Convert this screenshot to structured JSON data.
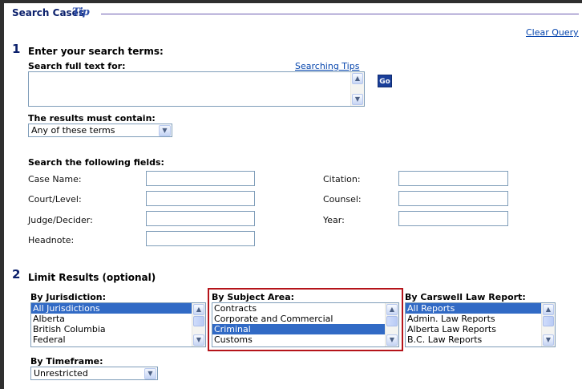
{
  "header": {
    "title": "Search Cases",
    "tip_logo": "Tip"
  },
  "clear_query": "Clear Query",
  "step1": {
    "number": "1",
    "heading": "Enter your search terms:",
    "full_text_label": "Search full text for:",
    "searching_tips": "Searching Tips",
    "full_text_value": "",
    "go_label": "Go",
    "must_contain_label": "The results must contain:",
    "must_contain_value": "Any of these terms"
  },
  "fields": {
    "heading": "Search the following fields:",
    "case_name": "Case Name:",
    "court_level": "Court/Level:",
    "judge_decider": "Judge/Decider:",
    "headnote": "Headnote:",
    "citation": "Citation:",
    "counsel": "Counsel:",
    "year": "Year:"
  },
  "step2": {
    "number": "2",
    "heading": "Limit Results (optional)",
    "jurisdiction": {
      "label": "By Jurisdiction:",
      "options": [
        "All Jurisdictions",
        "Alberta",
        "British Columbia",
        "Federal"
      ],
      "selected_index": 0
    },
    "subject": {
      "label": "By Subject Area:",
      "options": [
        "Contracts",
        "Corporate and Commercial",
        "Criminal",
        "Customs"
      ],
      "selected_index": 2
    },
    "law_report": {
      "label": "By Carswell Law Report:",
      "options": [
        "All Reports",
        "Admin. Law Reports",
        "Alberta Law Reports",
        "B.C. Law Reports"
      ],
      "selected_index": 0
    },
    "timeframe": {
      "label": "By Timeframe:",
      "value": "Unrestricted"
    }
  },
  "icons": {
    "dropdown": "chevron-down-icon",
    "scroll_up": "chevron-up-icon",
    "scroll_down": "chevron-down-icon"
  },
  "colors": {
    "heading": "#0a1f6b",
    "link": "#0645ad",
    "selection": "#316ac5",
    "highlight_border": "#b5141a",
    "go_button": "#1a3f9a"
  }
}
